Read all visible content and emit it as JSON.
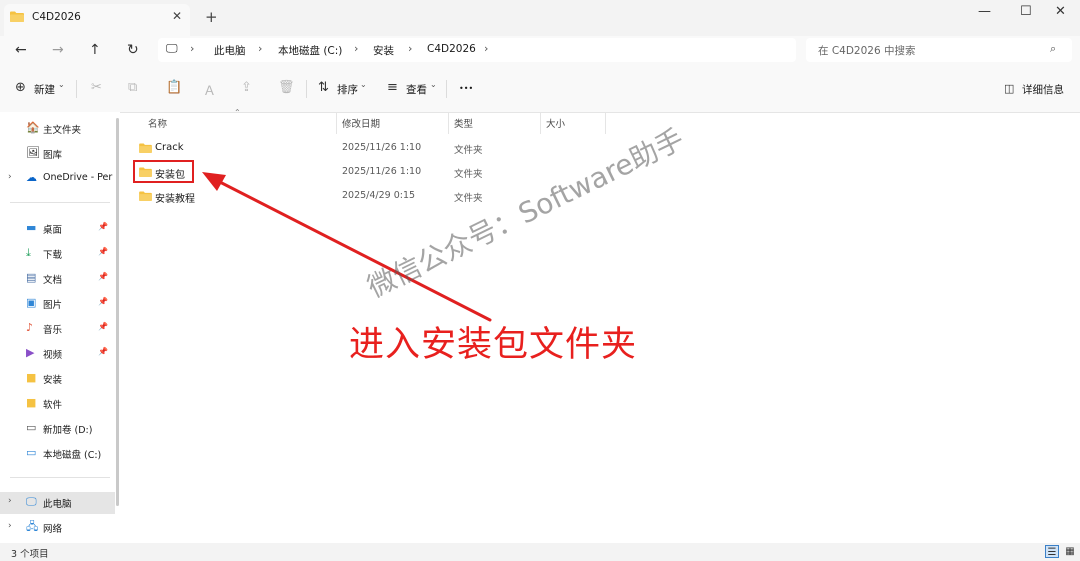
{
  "window": {
    "tab_title": "C4D2026",
    "tab_close": "✕",
    "new_tab": "+",
    "minimize": "—",
    "maximize": "☐",
    "close": "✕"
  },
  "nav": {
    "back": "←",
    "forward": "→",
    "up": "↑",
    "refresh": "↻"
  },
  "breadcrumb": {
    "computer_icon": "🖵",
    "items": [
      "此电脑",
      "本地磁盘 (C:)",
      "安装",
      "C4D2026"
    ],
    "separator": "›",
    "dropdown": "›"
  },
  "search": {
    "placeholder": "在 C4D2026 中搜索",
    "icon": "⌕"
  },
  "toolbar": {
    "new_label": "新建",
    "new_caret": "⌄",
    "sort_label": "排序",
    "sort_caret": "⌄",
    "view_label": "查看",
    "view_caret": "⌄",
    "more": "•••",
    "details_label": "详细信息"
  },
  "sidebar": {
    "home": "主文件夹",
    "gallery": "图库",
    "onedrive": "OneDrive - Per",
    "quick": [
      {
        "label": "桌面",
        "icon": "desktop-icon",
        "pinned": true
      },
      {
        "label": "下载",
        "icon": "download-icon",
        "pinned": true
      },
      {
        "label": "文档",
        "icon": "document-icon",
        "pinned": true
      },
      {
        "label": "图片",
        "icon": "pictures-icon",
        "pinned": true
      },
      {
        "label": "音乐",
        "icon": "music-icon",
        "pinned": true
      },
      {
        "label": "视频",
        "icon": "video-icon",
        "pinned": true
      },
      {
        "label": "安装",
        "icon": "folder-icon",
        "pinned": false
      },
      {
        "label": "软件",
        "icon": "folder-icon",
        "pinned": false
      },
      {
        "label": "新加卷 (D:)",
        "icon": "drive-icon",
        "pinned": false
      },
      {
        "label": "本地磁盘 (C:)",
        "icon": "drive-icon",
        "pinned": false
      }
    ],
    "this_pc": "此电脑",
    "network": "网络"
  },
  "columns": {
    "name": "名称",
    "modified": "修改日期",
    "type": "类型",
    "size": "大小"
  },
  "files": [
    {
      "name": "Crack",
      "modified": "2025/11/26 1:10",
      "type": "文件夹"
    },
    {
      "name": "安装包",
      "modified": "2025/11/26 1:10",
      "type": "文件夹"
    },
    {
      "name": "安装教程",
      "modified": "2025/4/29 0:15",
      "type": "文件夹"
    }
  ],
  "status": {
    "count_text": "3 个项目"
  },
  "annotation": {
    "text": "进入安装包文件夹",
    "watermark": "微信公众号：Software助手",
    "color": "#e8201e"
  },
  "colors": {
    "folder": "#f5c242",
    "accent": "#0067c0"
  }
}
